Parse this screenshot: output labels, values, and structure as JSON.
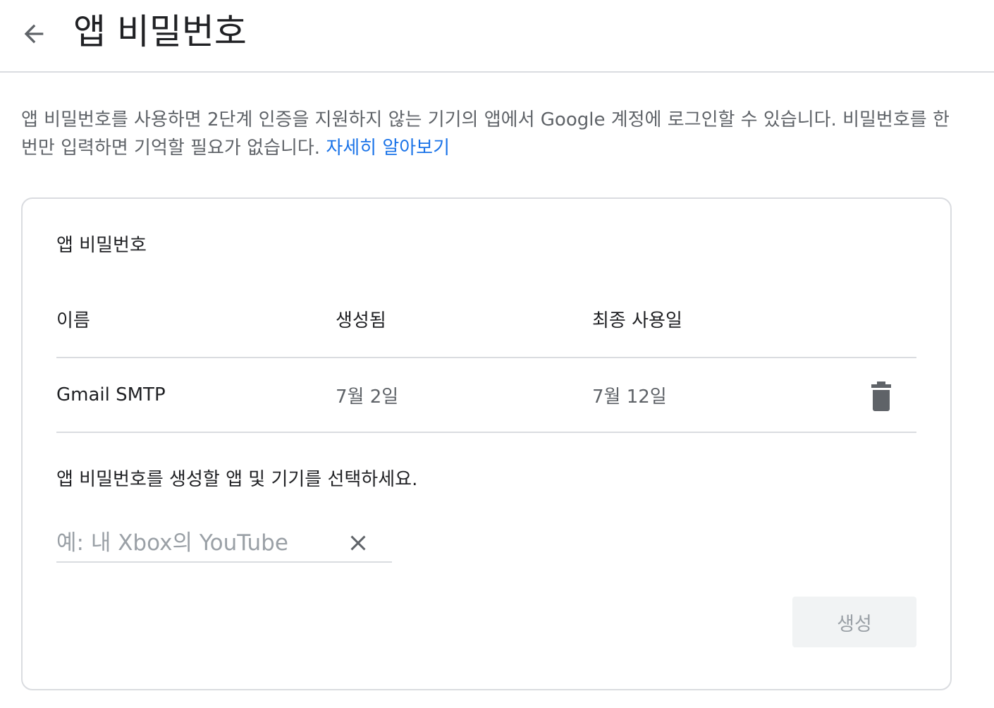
{
  "header": {
    "back_icon": "arrow-back-icon",
    "title": "앱 비밀번호"
  },
  "description": {
    "text": "앱 비밀번호를 사용하면 2단계 인증을 지원하지 않는 기기의 앱에서 Google 계정에 로그인할 수 있습니다. 비밀번호를 한 번만 입력하면 기억할 필요가 없습니다. ",
    "link_label": "자세히 알아보기"
  },
  "card": {
    "title": "앱 비밀번호",
    "table": {
      "headers": [
        "이름",
        "생성됨",
        "최종 사용일"
      ],
      "rows": [
        {
          "name": "Gmail SMTP",
          "created": "7월 2일",
          "last_used": "7월 12일",
          "action_icon": "trash-icon"
        }
      ]
    },
    "select_label": "앱 비밀번호를 생성할 앱 및 기기를 선택하세요.",
    "input": {
      "value": "",
      "placeholder": "예: 내 Xbox의 YouTube",
      "clear_icon": "close-icon"
    },
    "generate_label": "생성"
  },
  "colors": {
    "link": "#1a73e8",
    "divider": "#dadce0",
    "secondary_text": "#5f6368",
    "disabled_button_bg": "#f1f3f4",
    "disabled_button_text": "#9aa0a6"
  }
}
